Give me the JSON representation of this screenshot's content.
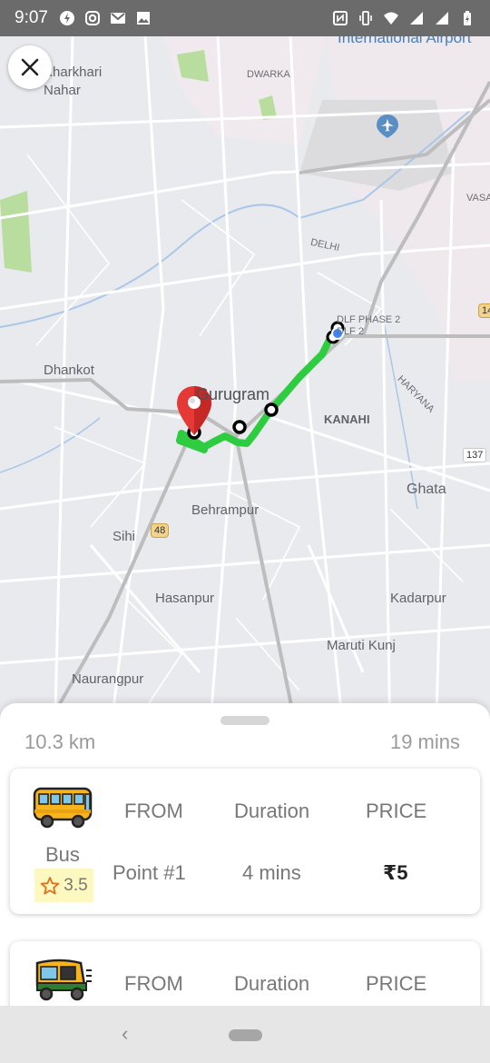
{
  "status_bar": {
    "time": "9:07",
    "left_icons": [
      "flash-app-icon",
      "instagram-icon",
      "gmail-icon",
      "gallery-icon"
    ],
    "right_icons": [
      "nfc-icon",
      "vibrate-icon",
      "wifi-icon",
      "signal-icon",
      "signal-icon",
      "battery-icon"
    ]
  },
  "map": {
    "labels": {
      "airport": "International Airport",
      "kharkhari": "Kharkhari Nahar",
      "dwarka": "DWARKA",
      "delhi": "DELHI",
      "dlf": "DLF PHASE 2 DLF 2",
      "vasant": "VASA",
      "dhankot": "Dhankot",
      "gurugram": "Gurugram",
      "kanahi": "KANAHI",
      "haryana": "HARYANA",
      "ghata": "Ghata",
      "behrampur": "Behrampur",
      "sihi": "Sihi",
      "hasanpur": "Hasanpur",
      "kadarpur": "Kadarpur",
      "maruti_kunj": "Maruti Kunj",
      "naurangpur": "Naurangpur"
    },
    "road_badges": {
      "nh48": "48",
      "r137": "137",
      "r14": "14"
    },
    "route_color": "#2ecc40",
    "pin_color": "#e53935",
    "current_location_color": "#4285f4"
  },
  "trip_summary": {
    "distance": "10.3 km",
    "duration": "19 mins"
  },
  "options": [
    {
      "icon": "bus-icon",
      "mode": "Bus",
      "rating": "3.5",
      "from_header": "FROM",
      "duration_header": "Duration",
      "price_header": "PRICE",
      "from": "Point #1",
      "duration": "4 mins",
      "price": "₹5"
    },
    {
      "icon": "auto-rickshaw-icon",
      "from_header": "FROM",
      "duration_header": "Duration",
      "price_header": "PRICE"
    }
  ],
  "nav": {
    "back": "‹"
  }
}
